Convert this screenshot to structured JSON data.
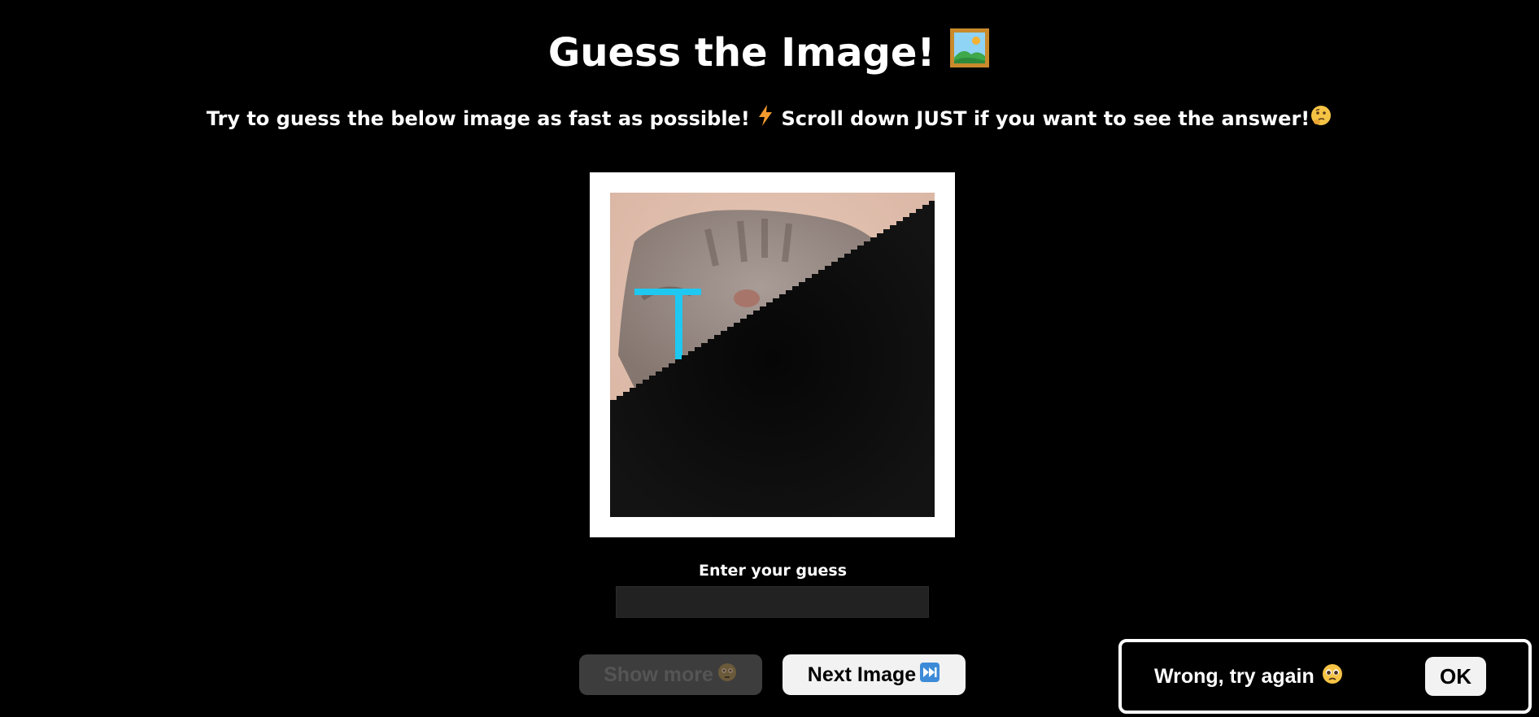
{
  "header": {
    "title": "Guess the Image!",
    "title_icon": "framed-picture-icon",
    "subtitle_part1": "Try to guess the below image as fast as possible!",
    "subtitle_icon1": "lightning-icon",
    "subtitle_part2": "Scroll down JUST if you want to see the answer!",
    "subtitle_icon2": "thinking-face-icon"
  },
  "image": {
    "content": "pixelated crying cat photo, partially covered by black diagonal mask",
    "reveal_fraction": 0.4
  },
  "guess": {
    "label": "Enter your guess",
    "value": "",
    "placeholder": ""
  },
  "buttons": {
    "show_more_label": "Show more",
    "show_more_icon": "flushed-face-icon",
    "show_more_disabled": true,
    "next_label": "Next Image",
    "next_icon": "fast-forward-icon"
  },
  "toast": {
    "message": "Wrong, try again",
    "icon": "pleading-face-icon",
    "ok_label": "OK"
  },
  "colors": {
    "background": "#000000",
    "frame": "#ffffff",
    "input_bg": "#222222",
    "disabled_button": "#3d3d3d",
    "button": "#f2f2f2",
    "tear_blue": "#1ec8f0"
  }
}
